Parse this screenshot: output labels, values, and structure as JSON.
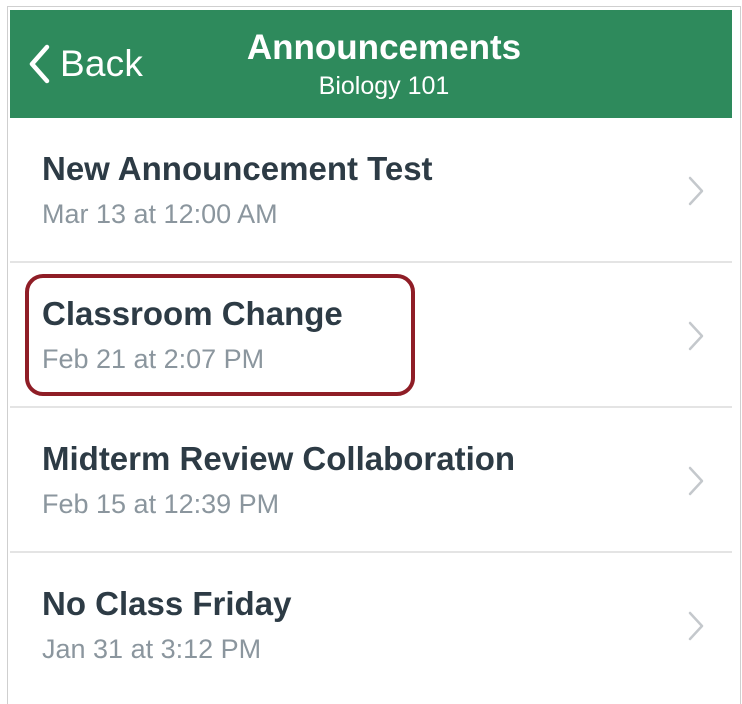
{
  "nav": {
    "back_label": "Back",
    "title": "Announcements",
    "subtitle": "Biology 101"
  },
  "announcements": [
    {
      "title": "New Announcement Test",
      "date": "Mar 13 at 12:00 AM"
    },
    {
      "title": "Classroom Change",
      "date": "Feb 21 at 2:07 PM"
    },
    {
      "title": "Midterm Review Collaboration",
      "date": "Feb 15 at 12:39 PM"
    },
    {
      "title": "No Class Friday",
      "date": "Jan 31 at 3:12 PM"
    }
  ],
  "icons": {
    "back": "chevron-left-icon",
    "row_disclosure": "chevron-right-icon"
  },
  "colors": {
    "nav_background": "#2e8a5c",
    "highlight_border": "#8f1d26",
    "title_text": "#2d3b45",
    "date_text": "#8b969e"
  },
  "highlighted_item": "Classroom Change"
}
